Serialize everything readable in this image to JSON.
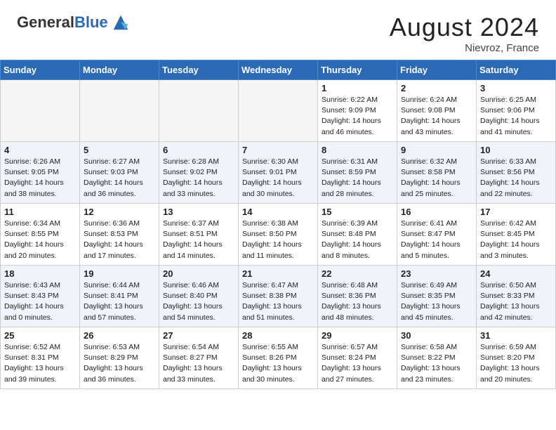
{
  "header": {
    "logo_general": "General",
    "logo_blue": "Blue",
    "month_title": "August 2024",
    "location": "Nievroz, France"
  },
  "days_of_week": [
    "Sunday",
    "Monday",
    "Tuesday",
    "Wednesday",
    "Thursday",
    "Friday",
    "Saturday"
  ],
  "weeks": [
    [
      {
        "day": "",
        "info": ""
      },
      {
        "day": "",
        "info": ""
      },
      {
        "day": "",
        "info": ""
      },
      {
        "day": "",
        "info": ""
      },
      {
        "day": "1",
        "info": "Sunrise: 6:22 AM\nSunset: 9:09 PM\nDaylight: 14 hours\nand 46 minutes."
      },
      {
        "day": "2",
        "info": "Sunrise: 6:24 AM\nSunset: 9:08 PM\nDaylight: 14 hours\nand 43 minutes."
      },
      {
        "day": "3",
        "info": "Sunrise: 6:25 AM\nSunset: 9:06 PM\nDaylight: 14 hours\nand 41 minutes."
      }
    ],
    [
      {
        "day": "4",
        "info": "Sunrise: 6:26 AM\nSunset: 9:05 PM\nDaylight: 14 hours\nand 38 minutes."
      },
      {
        "day": "5",
        "info": "Sunrise: 6:27 AM\nSunset: 9:03 PM\nDaylight: 14 hours\nand 36 minutes."
      },
      {
        "day": "6",
        "info": "Sunrise: 6:28 AM\nSunset: 9:02 PM\nDaylight: 14 hours\nand 33 minutes."
      },
      {
        "day": "7",
        "info": "Sunrise: 6:30 AM\nSunset: 9:01 PM\nDaylight: 14 hours\nand 30 minutes."
      },
      {
        "day": "8",
        "info": "Sunrise: 6:31 AM\nSunset: 8:59 PM\nDaylight: 14 hours\nand 28 minutes."
      },
      {
        "day": "9",
        "info": "Sunrise: 6:32 AM\nSunset: 8:58 PM\nDaylight: 14 hours\nand 25 minutes."
      },
      {
        "day": "10",
        "info": "Sunrise: 6:33 AM\nSunset: 8:56 PM\nDaylight: 14 hours\nand 22 minutes."
      }
    ],
    [
      {
        "day": "11",
        "info": "Sunrise: 6:34 AM\nSunset: 8:55 PM\nDaylight: 14 hours\nand 20 minutes."
      },
      {
        "day": "12",
        "info": "Sunrise: 6:36 AM\nSunset: 8:53 PM\nDaylight: 14 hours\nand 17 minutes."
      },
      {
        "day": "13",
        "info": "Sunrise: 6:37 AM\nSunset: 8:51 PM\nDaylight: 14 hours\nand 14 minutes."
      },
      {
        "day": "14",
        "info": "Sunrise: 6:38 AM\nSunset: 8:50 PM\nDaylight: 14 hours\nand 11 minutes."
      },
      {
        "day": "15",
        "info": "Sunrise: 6:39 AM\nSunset: 8:48 PM\nDaylight: 14 hours\nand 8 minutes."
      },
      {
        "day": "16",
        "info": "Sunrise: 6:41 AM\nSunset: 8:47 PM\nDaylight: 14 hours\nand 5 minutes."
      },
      {
        "day": "17",
        "info": "Sunrise: 6:42 AM\nSunset: 8:45 PM\nDaylight: 14 hours\nand 3 minutes."
      }
    ],
    [
      {
        "day": "18",
        "info": "Sunrise: 6:43 AM\nSunset: 8:43 PM\nDaylight: 14 hours\nand 0 minutes."
      },
      {
        "day": "19",
        "info": "Sunrise: 6:44 AM\nSunset: 8:41 PM\nDaylight: 13 hours\nand 57 minutes."
      },
      {
        "day": "20",
        "info": "Sunrise: 6:46 AM\nSunset: 8:40 PM\nDaylight: 13 hours\nand 54 minutes."
      },
      {
        "day": "21",
        "info": "Sunrise: 6:47 AM\nSunset: 8:38 PM\nDaylight: 13 hours\nand 51 minutes."
      },
      {
        "day": "22",
        "info": "Sunrise: 6:48 AM\nSunset: 8:36 PM\nDaylight: 13 hours\nand 48 minutes."
      },
      {
        "day": "23",
        "info": "Sunrise: 6:49 AM\nSunset: 8:35 PM\nDaylight: 13 hours\nand 45 minutes."
      },
      {
        "day": "24",
        "info": "Sunrise: 6:50 AM\nSunset: 8:33 PM\nDaylight: 13 hours\nand 42 minutes."
      }
    ],
    [
      {
        "day": "25",
        "info": "Sunrise: 6:52 AM\nSunset: 8:31 PM\nDaylight: 13 hours\nand 39 minutes."
      },
      {
        "day": "26",
        "info": "Sunrise: 6:53 AM\nSunset: 8:29 PM\nDaylight: 13 hours\nand 36 minutes."
      },
      {
        "day": "27",
        "info": "Sunrise: 6:54 AM\nSunset: 8:27 PM\nDaylight: 13 hours\nand 33 minutes."
      },
      {
        "day": "28",
        "info": "Sunrise: 6:55 AM\nSunset: 8:26 PM\nDaylight: 13 hours\nand 30 minutes."
      },
      {
        "day": "29",
        "info": "Sunrise: 6:57 AM\nSunset: 8:24 PM\nDaylight: 13 hours\nand 27 minutes."
      },
      {
        "day": "30",
        "info": "Sunrise: 6:58 AM\nSunset: 8:22 PM\nDaylight: 13 hours\nand 23 minutes."
      },
      {
        "day": "31",
        "info": "Sunrise: 6:59 AM\nSunset: 8:20 PM\nDaylight: 13 hours\nand 20 minutes."
      }
    ]
  ]
}
